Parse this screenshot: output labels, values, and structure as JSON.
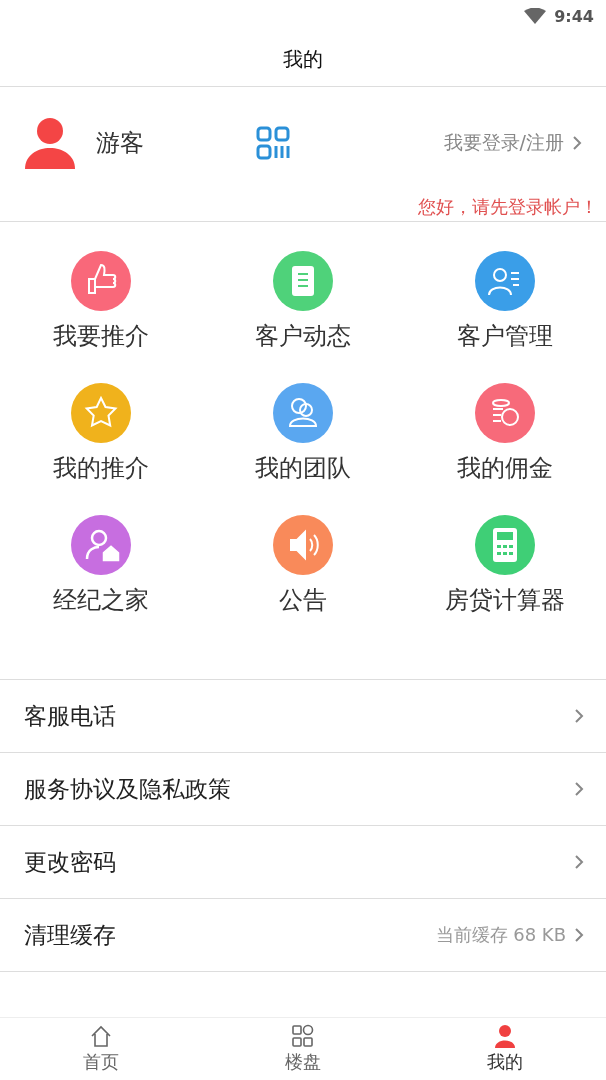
{
  "status_bar": {
    "time": "9:44"
  },
  "header": {
    "title": "我的"
  },
  "profile": {
    "name": "游客",
    "login_link": "我要登录/注册",
    "hint": "您好，请先登录帐户！"
  },
  "features": [
    {
      "label": "我要推介",
      "color": "#f9687a"
    },
    {
      "label": "客户动态",
      "color": "#4fd27a"
    },
    {
      "label": "客户管理",
      "color": "#3a9ee8"
    },
    {
      "label": "我的推介",
      "color": "#f0b21c"
    },
    {
      "label": "我的团队",
      "color": "#5aa7f0"
    },
    {
      "label": "我的佣金",
      "color": "#f76a7a"
    },
    {
      "label": "经纪之家",
      "color": "#c76ee0"
    },
    {
      "label": "公告",
      "color": "#f98a5a"
    },
    {
      "label": "房贷计算器",
      "color": "#3fcf76"
    }
  ],
  "menu": [
    {
      "label": "客服电话"
    },
    {
      "label": "服务协议及隐私政策"
    },
    {
      "label": "更改密码"
    },
    {
      "label": "清理缓存",
      "value": "当前缓存 68 KB"
    }
  ],
  "tabs": [
    {
      "label": "首页",
      "selected": false
    },
    {
      "label": "楼盘",
      "selected": false
    },
    {
      "label": "我的",
      "selected": true
    }
  ]
}
